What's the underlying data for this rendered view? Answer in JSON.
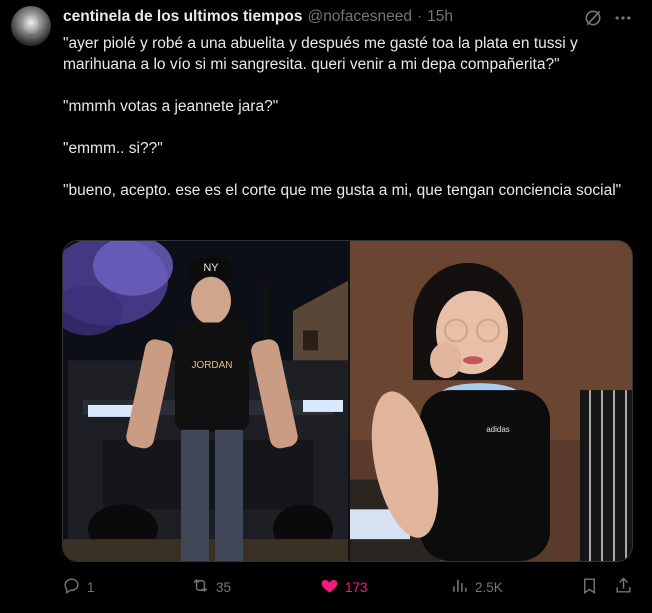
{
  "author": {
    "name": "centinela de los ultimos tiempos",
    "handle": "@nofacesneed",
    "separator": "·",
    "time": "15h"
  },
  "tweet": {
    "paragraphs": [
      "\"ayer piolé y robé a una abuelita y después me gasté toa la plata en tussi y marihuana a lo vío si mi sangresita. queri venir a mi depa compañerita?\"",
      "\"mmmh votas a jeannete jara?\"",
      "\"emmm.. si??\"",
      "\"bueno, acepto. ese es el corte que me gusta a mi, que tengan conciencia social\""
    ]
  },
  "media": {
    "left_cap_text": "NY",
    "left_shirt_text": "JORDAN",
    "right_logo_text": "adidas"
  },
  "actions": {
    "replies": "1",
    "retweets": "35",
    "likes": "173",
    "views": "2.5K"
  },
  "icons": {
    "avatar": "avatar-face",
    "grok": "grok-icon",
    "more": "more-icon",
    "reply": "reply-icon",
    "retweet": "retweet-icon",
    "like": "heart-icon",
    "views": "views-icon",
    "bookmark": "bookmark-icon",
    "share": "share-icon"
  },
  "colors": {
    "background": "#000000",
    "text": "#e7e9ea",
    "muted": "#71767b",
    "like": "#f91880"
  }
}
